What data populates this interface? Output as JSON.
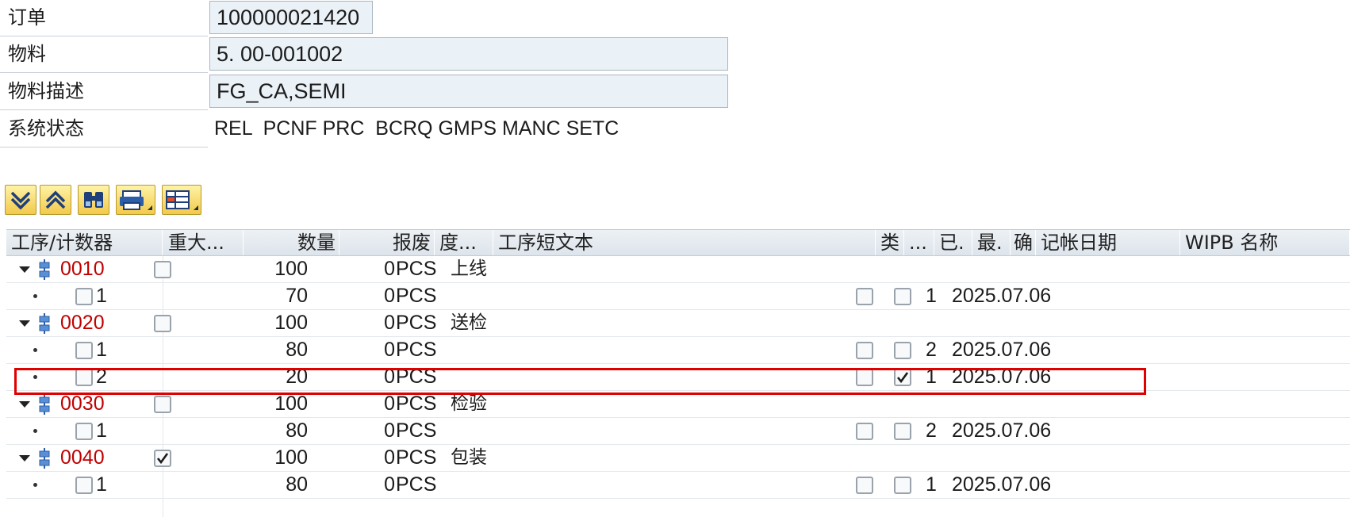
{
  "header": {
    "order_label": "订单",
    "order_value": "100000021420",
    "material_label": "物料",
    "material_value": "5. 00-001002",
    "desc_label": "物料描述",
    "desc_value": "FG_CA,SEMI",
    "status_label": "系统状态",
    "status_value": "REL  PCNF PRC  BCRQ GMPS MANC SETC"
  },
  "toolbar": {
    "icons": [
      "expand-all-icon",
      "collapse-all-icon",
      "find-icon",
      "print-icon",
      "layout-icon"
    ]
  },
  "columns": {
    "op": "工序/计数器",
    "major": "重大...",
    "qty": "数量",
    "scrap": "报废",
    "unit": "度...",
    "text": "工序短文本",
    "type": "类",
    "dots": "...",
    "done": "已.",
    "final": "最.",
    "conf": "确",
    "date": "记帐日期",
    "wipb": "WIPB 名称"
  },
  "rows": [
    {
      "kind": "op",
      "op": "0010",
      "major": false,
      "qty": "100",
      "scrap": "0",
      "unit": "PCS",
      "text": "上线"
    },
    {
      "kind": "sub",
      "counter": "1",
      "qty": "70",
      "scrap": "0",
      "unit": "PCS",
      "done": false,
      "final": false,
      "conf": "1",
      "date": "2025.07.06"
    },
    {
      "kind": "op",
      "op": "0020",
      "major": false,
      "qty": "100",
      "scrap": "0",
      "unit": "PCS",
      "text": "送检"
    },
    {
      "kind": "sub",
      "counter": "1",
      "qty": "80",
      "scrap": "0",
      "unit": "PCS",
      "done": false,
      "final": false,
      "conf": "2",
      "date": "2025.07.06"
    },
    {
      "kind": "sub",
      "counter": "2",
      "qty": "20",
      "scrap": "0",
      "unit": "PCS",
      "done": false,
      "final": true,
      "conf": "1",
      "date": "2025.07.06"
    },
    {
      "kind": "op",
      "op": "0030",
      "major": false,
      "qty": "100",
      "scrap": "0",
      "unit": "PCS",
      "text": "检验"
    },
    {
      "kind": "sub",
      "counter": "1",
      "qty": "80",
      "scrap": "0",
      "unit": "PCS",
      "done": false,
      "final": false,
      "conf": "2",
      "date": "2025.07.06"
    },
    {
      "kind": "op",
      "op": "0040",
      "major": true,
      "qty": "100",
      "scrap": "0",
      "unit": "PCS",
      "text": "包装"
    },
    {
      "kind": "sub",
      "counter": "1",
      "qty": "80",
      "scrap": "0",
      "unit": "PCS",
      "done": false,
      "final": false,
      "conf": "1",
      "date": "2025.07.06"
    }
  ],
  "colors": {
    "op_number": "#c00000",
    "highlight": "#e00000",
    "toolbar": "#f2c94b"
  }
}
